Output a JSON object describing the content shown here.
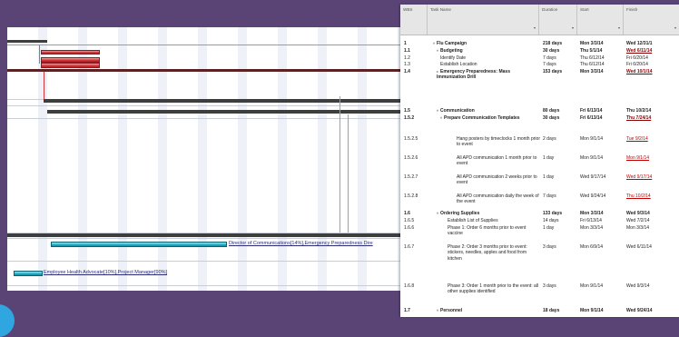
{
  "colors": {
    "background": "#5a4475",
    "summary_bar": "#3e3e3e",
    "critical_bar": "#d4373c",
    "task_bar": "#27b2c8",
    "late_date": "#c00000"
  },
  "gantt": {
    "label_director": "Director of Communications[14%],Emergency Preparedness Dire",
    "label_employee": "Employee Health Advocate[10%],Project Manager[90%]"
  },
  "table": {
    "headers": {
      "wbs": "WBS",
      "task_name": "Task Name",
      "duration": "Duration",
      "start": "Start",
      "finish": "Finish"
    },
    "rows": [
      {
        "wbs": "1",
        "name": "Flu Campaign",
        "toggle": "▿",
        "dur": "218 days",
        "start": "Mon 3/3/14",
        "finish": "Wed 12/31/1"
      },
      {
        "wbs": "1.1",
        "name": "Budgeting",
        "toggle": "▿",
        "dur": "30 days",
        "start": "Thu 5/1/14",
        "finish": "Wed 6/11/14"
      },
      {
        "wbs": "1.2",
        "name": "Identify Date",
        "toggle": "",
        "dur": "7 days",
        "start": "Thu 6/12/14",
        "finish": "Fri 6/20/14"
      },
      {
        "wbs": "1.3",
        "name": "Establish Location",
        "toggle": "",
        "dur": "7 days",
        "start": "Thu 6/12/14",
        "finish": "Fri 6/20/14"
      },
      {
        "wbs": "1.4",
        "name": "Emergency Preparedness: Mass Immunization Drill",
        "toggle": "▹",
        "dur": "153 days",
        "start": "Mon 3/3/14",
        "finish": "Wed 10/1/14"
      },
      {
        "wbs": "1.5",
        "name": "Communication",
        "toggle": "▿",
        "dur": "80 days",
        "start": "Fri 6/13/14",
        "finish": "Thu 10/2/14"
      },
      {
        "wbs": "1.5.2",
        "name": "Prepare Communication Templates",
        "toggle": "▿",
        "dur": "30 days",
        "start": "Fri 6/13/14",
        "finish": "Thu 7/24/14"
      },
      {
        "wbs": "1.5.2.5",
        "name": "Hang posters by timeclocks 1 month prior to event",
        "toggle": "",
        "dur": "2 days",
        "start": "Mon 9/1/14",
        "finish": "Tue 9/2/14"
      },
      {
        "wbs": "1.5.2.6",
        "name": "All APD communication 1 month prior to event",
        "toggle": "",
        "dur": "1 day",
        "start": "Mon 9/1/14",
        "finish": "Mon 9/1/14"
      },
      {
        "wbs": "1.5.2.7",
        "name": "All APD communication 2 weeks prior to event",
        "toggle": "",
        "dur": "1 day",
        "start": "Wed 9/17/14",
        "finish": "Wed 9/17/14"
      },
      {
        "wbs": "1.5.2.8",
        "name": "All APD communication daily the week of the event",
        "toggle": "",
        "dur": "7 days",
        "start": "Wed 9/24/14",
        "finish": "Thu 10/2/14"
      },
      {
        "wbs": "1.6",
        "name": "Ordering Supplies",
        "toggle": "▿",
        "dur": "133 days",
        "start": "Mon 3/3/14",
        "finish": "Wed 9/3/14"
      },
      {
        "wbs": "1.6.5",
        "name": "Establish List of Supplies",
        "toggle": "",
        "dur": "14 days",
        "start": "Fri 6/13/14",
        "finish": "Wed 7/2/14"
      },
      {
        "wbs": "1.6.6",
        "name": "Phase 1: Order 6 months prior to event vaccine",
        "toggle": "",
        "dur": "1 day",
        "start": "Mon 3/3/14",
        "finish": "Mon 3/3/14"
      },
      {
        "wbs": "1.6.7",
        "name": "Phase 2: Order 3 months prior to event: stickers, needles, apples and food from kitchen",
        "toggle": "",
        "dur": "3 days",
        "start": "Mon 6/9/14",
        "finish": "Wed 6/11/14"
      },
      {
        "wbs": "1.6.8",
        "name": "Phase 3: Order 1 month prior to the event: all other supplies identified",
        "toggle": "",
        "dur": "3 days",
        "start": "Mon 9/1/14",
        "finish": "Wed 9/3/14"
      },
      {
        "wbs": "1.7",
        "name": "Personnel",
        "toggle": "▿",
        "dur": "18 days",
        "start": "Mon 9/1/14",
        "finish": "Wed 9/24/14"
      }
    ]
  }
}
